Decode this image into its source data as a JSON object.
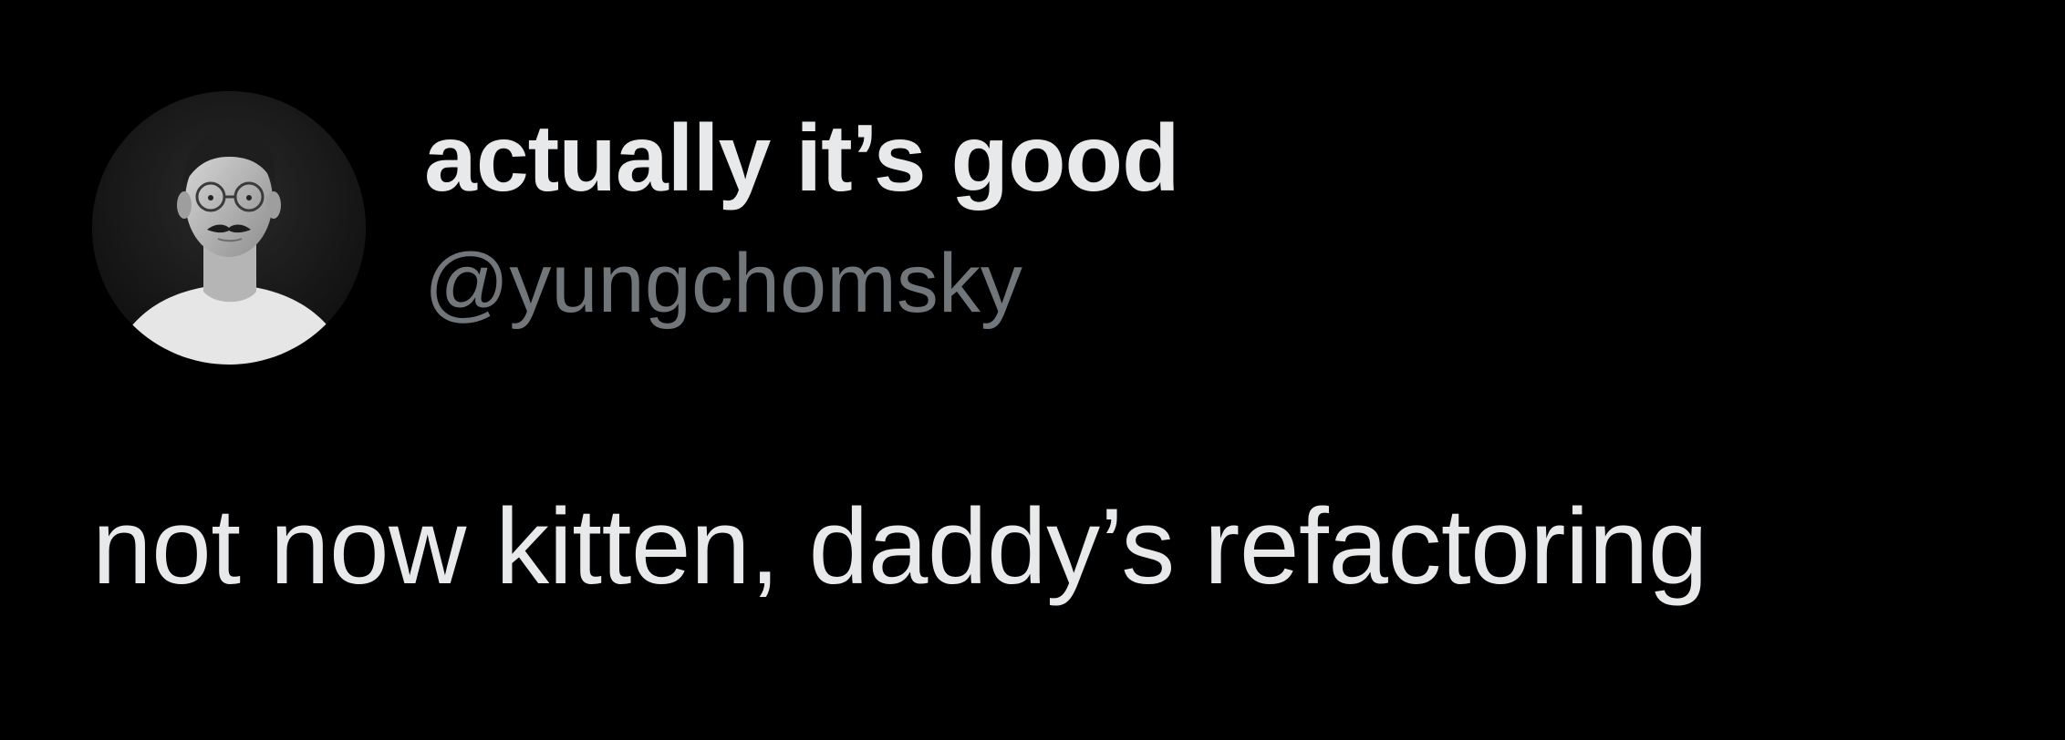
{
  "tweet": {
    "author": {
      "display_name": "actually it’s good",
      "handle": "@yungchomsky",
      "avatar_icon": "avatar-photo-man-mustache"
    },
    "text": "not now kitten, daddy’s refactoring"
  },
  "colors": {
    "background": "#000000",
    "primary_text": "#e7e9ea",
    "secondary_text": "#71767b"
  }
}
